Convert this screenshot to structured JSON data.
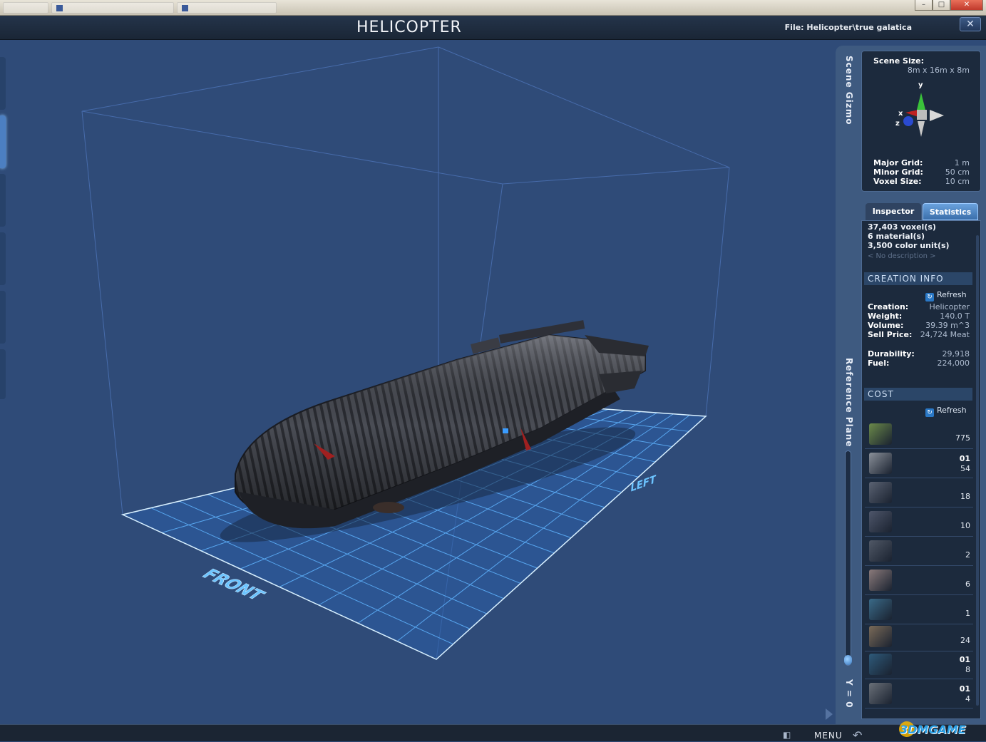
{
  "window": {
    "title": "HELICOPTER",
    "file_path": "File:  Helicopter\\true galatica",
    "close_label": "✕",
    "os_buttons": [
      "–",
      "□",
      "✕"
    ]
  },
  "viewport": {
    "front_label": "FRONT",
    "left_label": "LEFT"
  },
  "side_labels": {
    "scene_gizmo": "Scene Gizmo",
    "reference_plane": "Reference Plane",
    "y_readout": "Y = 0"
  },
  "gizmo": {
    "scene_size_label": "Scene Size:",
    "scene_size_value": "8m x 16m x 8m",
    "axes": [
      "y",
      "x",
      "z"
    ],
    "major_grid_label": "Major Grid:",
    "major_grid_value": "1 m",
    "minor_grid_label": "Minor Grid:",
    "minor_grid_value": "50 cm",
    "voxel_size_label": "Voxel Size:",
    "voxel_size_value": "10 cm"
  },
  "tabs": [
    {
      "label": "Inspector",
      "active": false
    },
    {
      "label": "Statistics",
      "active": true
    }
  ],
  "statistics": {
    "voxels": "37,403 voxel(s)",
    "materials": "6 material(s)",
    "color_units": "3,500 color unit(s)",
    "description": "< No description >"
  },
  "creation_info": {
    "header": "CREATION INFO",
    "refresh_label": "Refresh",
    "rows": [
      {
        "label": "Creation:",
        "value": "Helicopter"
      },
      {
        "label": "Weight:",
        "value": "140.0 T"
      },
      {
        "label": "Volume:",
        "value": "39.39 m^3"
      },
      {
        "label": "Sell Price:",
        "value": "24,724 Meat"
      }
    ],
    "rows2": [
      {
        "label": "Durability:",
        "value": "29,918"
      },
      {
        "label": "Fuel:",
        "value": "224,000"
      }
    ]
  },
  "cost": {
    "header": "COST",
    "refresh_label": "Refresh",
    "items": [
      {
        "icon": "green-block-icon",
        "top": "",
        "value": "775",
        "color": "#6b8a4a"
      },
      {
        "icon": "thruster-icon",
        "top": "01",
        "value": "54",
        "color": "#8a9099"
      },
      {
        "icon": "cannon-icon",
        "top": "",
        "value": "18",
        "color": "#5a6272"
      },
      {
        "icon": "turret-icon",
        "top": "",
        "value": "10",
        "color": "#4e566a"
      },
      {
        "icon": "gun-barrel-icon",
        "top": "",
        "value": "2",
        "color": "#505866"
      },
      {
        "icon": "seat-icon",
        "top": "",
        "value": "6",
        "color": "#8a7a7a"
      },
      {
        "icon": "cockpit-icon",
        "top": "",
        "value": "1",
        "color": "#3a6a88"
      },
      {
        "icon": "wheel-icon",
        "top": "",
        "value": "24",
        "color": "#7a6a58"
      },
      {
        "icon": "engine-icon",
        "top": "01",
        "value": "8",
        "color": "#2e5a7a"
      },
      {
        "icon": "landing-gear-icon",
        "top": "01",
        "value": "4",
        "color": "#6a7078"
      }
    ]
  },
  "bottom_bar": {
    "menu_label": "MENU",
    "watermark": "3DMGAME"
  }
}
